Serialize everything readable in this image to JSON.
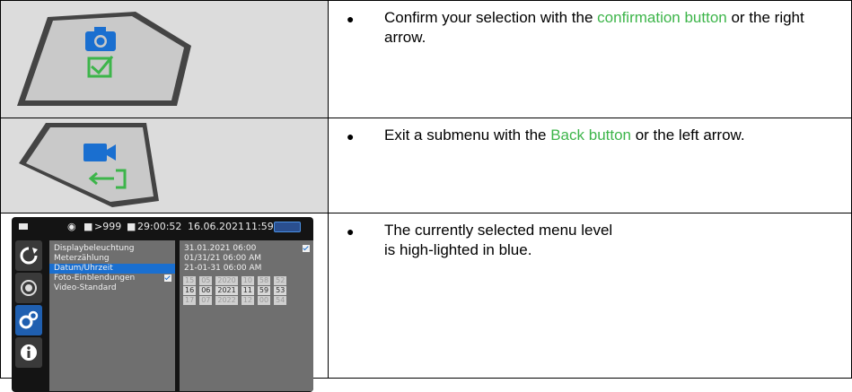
{
  "rows": [
    {
      "pre": "Confirm your selection with the ",
      "highlight": "confirmation button",
      "post": " or the right arrow.",
      "icon": "camera-confirm-button"
    },
    {
      "pre": "Exit a submenu with the ",
      "highlight": "Back button",
      "post": " or the left arrow.",
      "icon": "video-back-button"
    },
    {
      "text": "The currently selected menu level is high-lighted in blue."
    }
  ],
  "device": {
    "status": {
      "shots": ">999",
      "recording_time": "29:00:52",
      "date": "16.06.2021",
      "time": "11:59"
    },
    "menu_items": [
      "Displaybeleuchtung",
      "Meterzählung",
      "Datum/Uhrzeit",
      "Foto-Einblendungen",
      "Video-Standard"
    ],
    "selected_index": 2,
    "date_formats": [
      "31.01.2021 06:00",
      "01/31/21 06:00 AM",
      "21-01-31 06:00 AM"
    ],
    "picker": [
      [
        "15",
        "16",
        "17"
      ],
      [
        "05",
        "06",
        "07"
      ],
      [
        "2020",
        "2021",
        "2022"
      ],
      [
        "10",
        "11",
        "12"
      ],
      [
        "58",
        "59",
        "00"
      ],
      [
        "52",
        "53",
        "54"
      ]
    ]
  },
  "colors": {
    "highlight_text": "#3db54a",
    "button_fill": "#1a6fd0",
    "button_green": "#3db54a"
  }
}
